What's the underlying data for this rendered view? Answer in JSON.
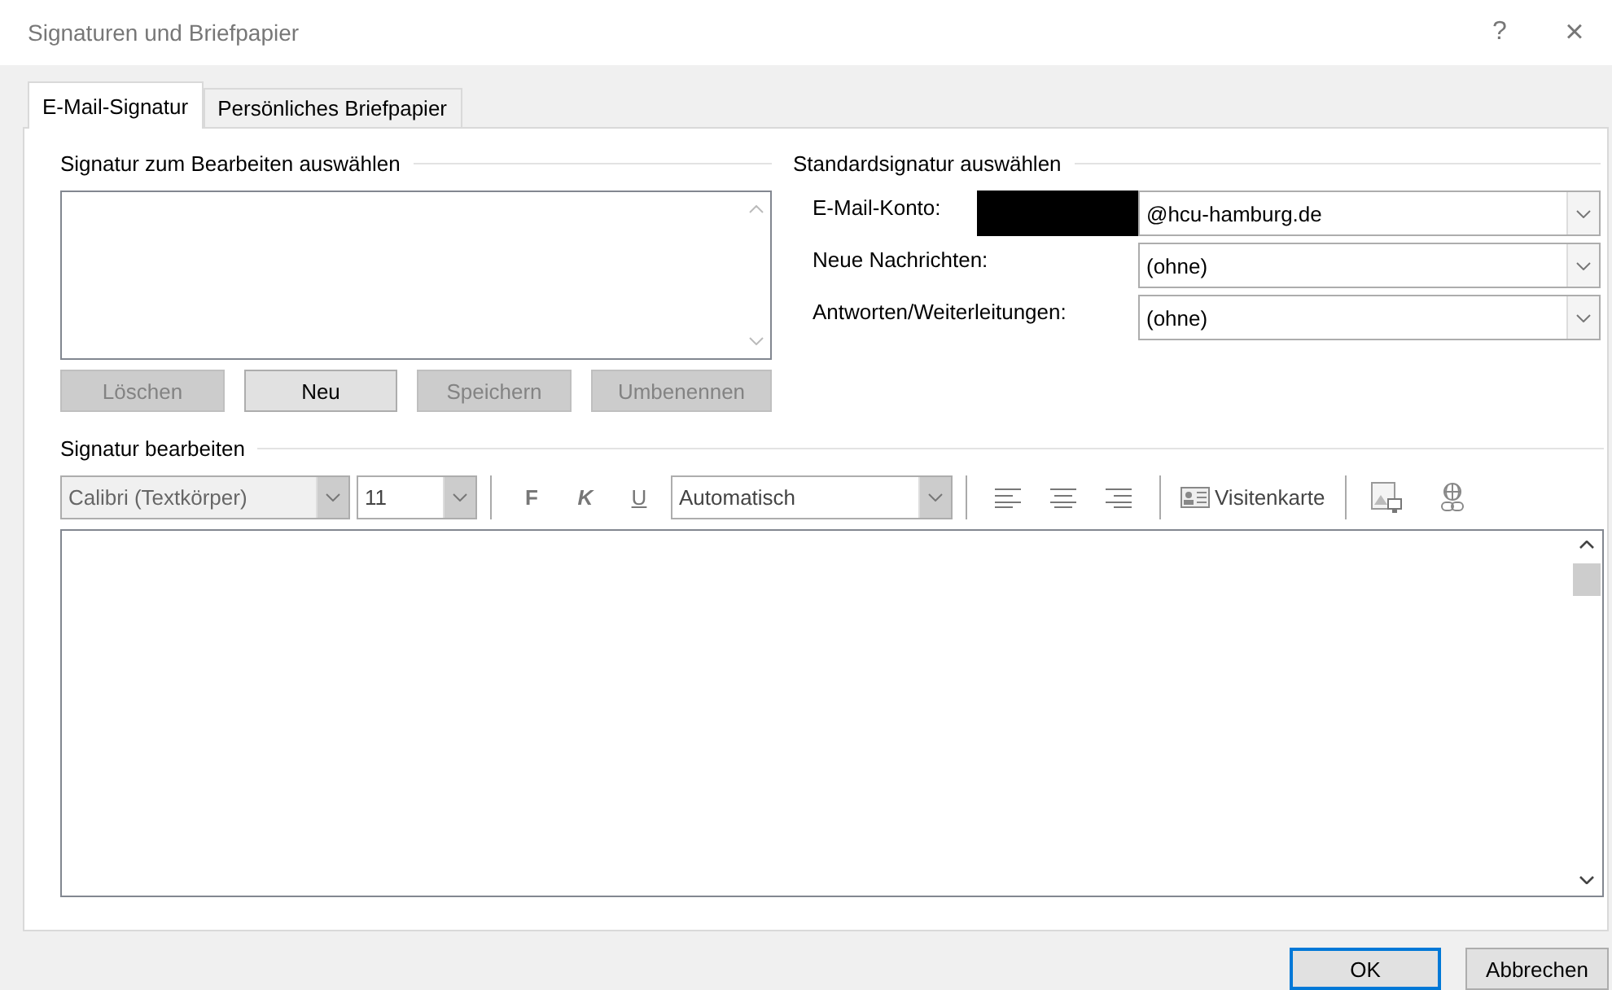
{
  "window": {
    "title": "Signaturen und Briefpapier",
    "help": "?",
    "close": "×"
  },
  "tabs": [
    {
      "label": "E-Mail-Signatur",
      "selected": true
    },
    {
      "label": "Persönliches Briefpapier",
      "selected": false
    }
  ],
  "select_signature": {
    "title": "Signatur zum Bearbeiten auswählen",
    "buttons": [
      {
        "label": "Löschen",
        "disabled": true
      },
      {
        "label": "Neu",
        "disabled": false
      },
      {
        "label": "Speichern",
        "disabled": true
      },
      {
        "label": "Umbenennen",
        "disabled": true
      }
    ]
  },
  "default_signature": {
    "title": "Standardsignatur auswählen",
    "fields": [
      {
        "label": "E-Mail-Konto:",
        "value": "@hcu-hamburg.de",
        "redacted": true
      },
      {
        "label": "Neue Nachrichten:",
        "value": "(ohne)",
        "redacted": false
      },
      {
        "label": "Antworten/Weiterleitungen:",
        "value": "(ohne)",
        "redacted": false
      }
    ]
  },
  "edit_signature": {
    "title": "Signatur bearbeiten",
    "toolbar": {
      "font": {
        "value": "Calibri (Textkörper)",
        "disabled": true
      },
      "size": {
        "value": "11",
        "disabled": false
      },
      "bold": "F",
      "italic": "K",
      "underline": "U",
      "color": {
        "value": "Automatisch",
        "disabled": false
      },
      "business_card": "Visitenkarte"
    }
  },
  "footer": {
    "buttons": [
      {
        "label": "OK",
        "default": true
      },
      {
        "label": "Abbrechen",
        "default": false
      }
    ]
  }
}
